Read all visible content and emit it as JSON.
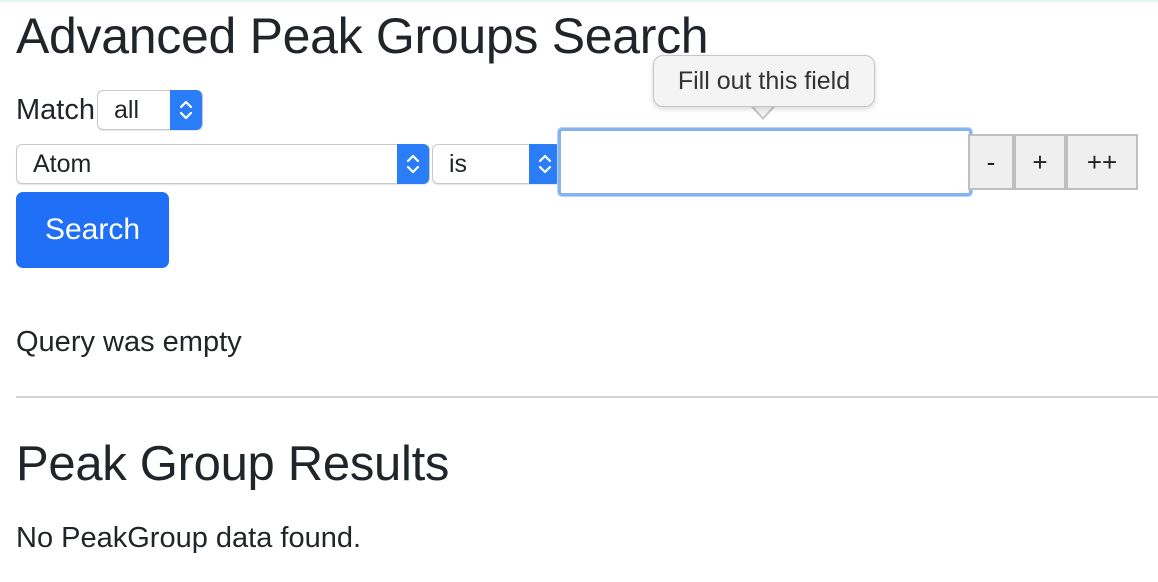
{
  "page": {
    "title": "Advanced Peak Groups Search"
  },
  "search_form": {
    "match_label": "Match",
    "match_select": {
      "selected": "all"
    },
    "field_select": {
      "selected": "Atom"
    },
    "operator_select": {
      "selected": "is"
    },
    "value_input": {
      "value": "",
      "placeholder": ""
    },
    "remove_button_label": "-",
    "add_button_label": "+",
    "add_group_button_label": "++",
    "search_button_label": "Search"
  },
  "validation_tooltip": {
    "text": "Fill out this field"
  },
  "status": {
    "message": "Query was empty"
  },
  "results": {
    "heading": "Peak Group Results",
    "empty_message": "No PeakGroup data found."
  },
  "colors": {
    "primary_button": "#1f6ff7",
    "select_arrow": "#2b7cf7",
    "focus_ring": "#85b3f0",
    "text": "#212529"
  },
  "icons": {
    "select_arrow": "chevron-up-down-icon"
  }
}
